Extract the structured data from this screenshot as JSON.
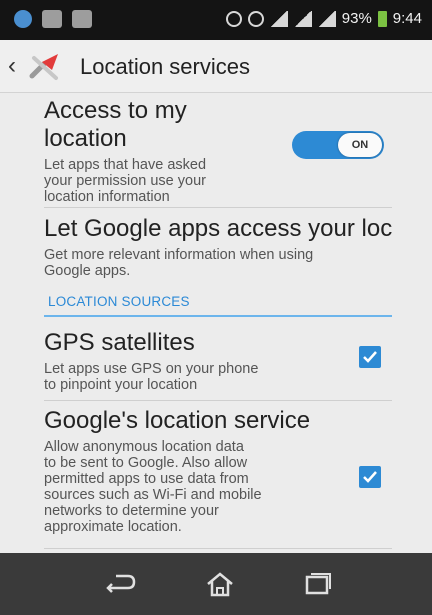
{
  "status_bar": {
    "battery_percent": "93%",
    "time": "9:44"
  },
  "app_bar": {
    "title": "Location services",
    "back_icon": "chevron-left-icon",
    "app_icon": "location-settings-icon"
  },
  "settings": {
    "access": {
      "title_line1": "Access to my",
      "title_line2": "location",
      "desc_line1": "Let apps that have asked",
      "desc_line2": "your permission use your",
      "desc_line3": "location information",
      "toggle_state": "ON"
    },
    "google_apps": {
      "title": "Let Google apps access your loc",
      "desc_line1": "Get more relevant information when using",
      "desc_line2": "Google apps."
    },
    "section_header": "LOCATION SOURCES",
    "gps": {
      "title": "GPS satellites",
      "desc_line1": "Let apps use GPS on your phone",
      "desc_line2": "to pinpoint your location",
      "checked": true
    },
    "google_service": {
      "title": "Google's location service",
      "desc_lines": [
        "Allow anonymous location data",
        "to be sent to Google. Also allow",
        "permitted apps to use data from",
        "sources such as Wi-Fi and mobile",
        "networks to determine your",
        "approximate location."
      ],
      "checked": true
    }
  },
  "nav_bar": {
    "back_icon": "back-arrow-icon",
    "home_icon": "home-icon",
    "recents_icon": "recent-apps-icon"
  },
  "colors": {
    "accent": "#2d8ad4",
    "section_text": "#2b89d6"
  }
}
